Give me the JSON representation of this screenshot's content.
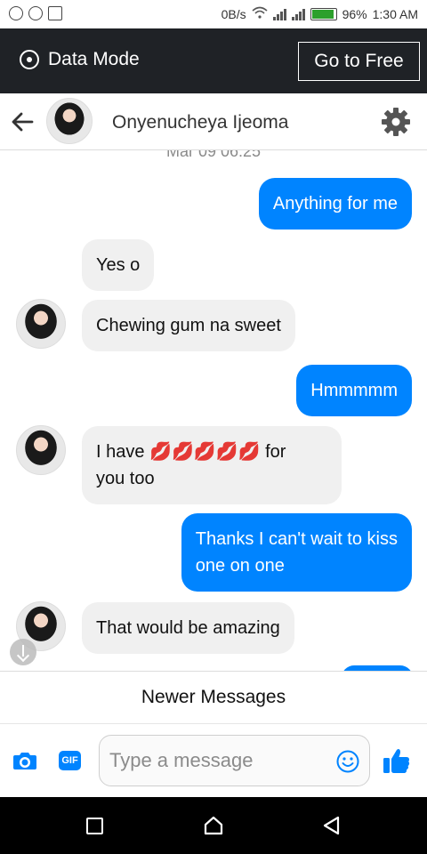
{
  "status_bar": {
    "speed": "0B/s",
    "battery": "96%",
    "time": "1:30 AM"
  },
  "data_mode": {
    "label": "Data Mode",
    "go_free_label": "Go to Free"
  },
  "header": {
    "contact_name": "Onyenucheya Ijeoma"
  },
  "messages": {
    "timestamp": "Mar 09 06:25",
    "items": [
      {
        "direction": "out",
        "text": "Anything for me"
      },
      {
        "direction": "in",
        "text": "Yes o"
      },
      {
        "direction": "in",
        "text": "Chewing gum na sweet"
      },
      {
        "direction": "out",
        "text": "Hmmmmm"
      },
      {
        "direction": "in",
        "text_before": "I have",
        "emoji": "💋💋💋💋💋",
        "text_after": "for",
        "text_line2": "you too"
      },
      {
        "direction": "out",
        "line1": "Thanks I can't wait to kiss",
        "line2": "one on one"
      },
      {
        "direction": "in",
        "text": "That would be amazing"
      }
    ]
  },
  "newer_messages": "Newer Messages",
  "composer": {
    "placeholder": "Type a message",
    "gif_label": "GIF"
  },
  "colors": {
    "accent": "#0084ff",
    "incoming_bubble": "#f0f0f0",
    "data_bar": "#1f2226"
  },
  "icons": [
    "back-arrow-icon",
    "gear-icon",
    "camera-icon",
    "gif-icon",
    "emoji-icon",
    "like-icon",
    "nav-recents-icon",
    "nav-home-icon",
    "nav-back-icon"
  ]
}
